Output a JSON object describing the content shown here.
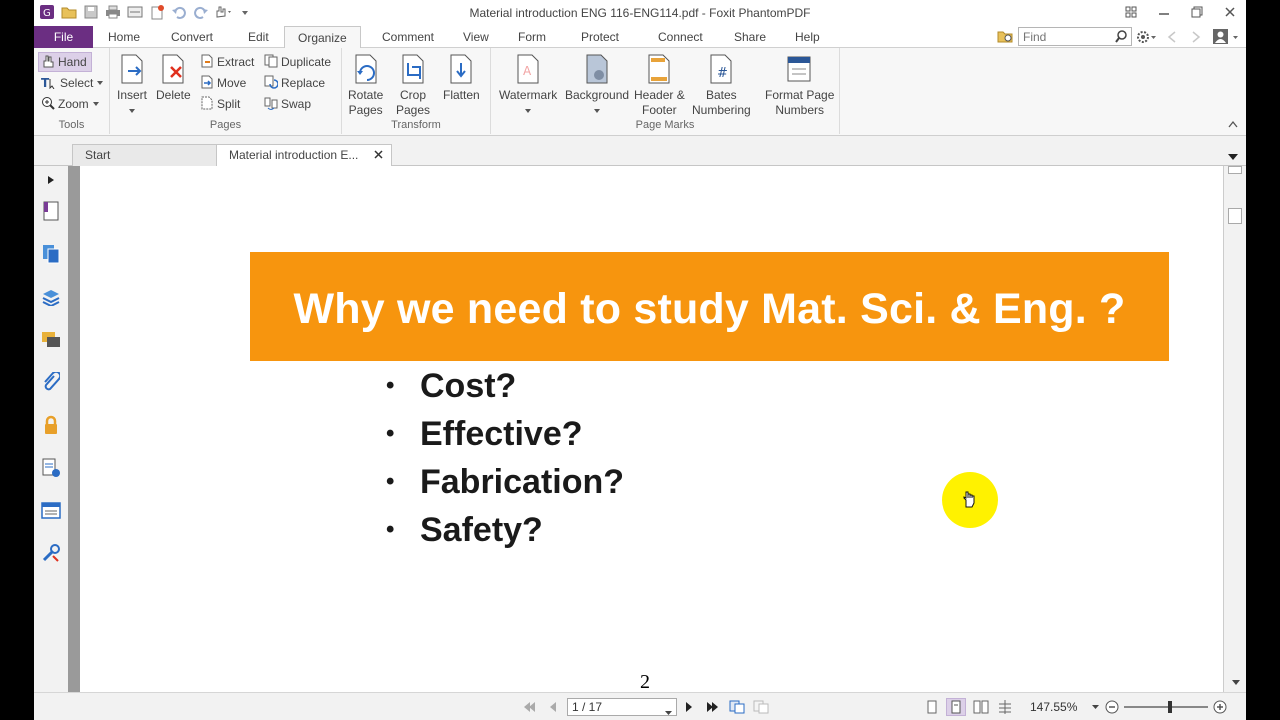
{
  "window": {
    "title": "Material introduction ENG 116-ENG114.pdf - Foxit PhantomPDF"
  },
  "menu": {
    "file": "File",
    "tabs": [
      "Home",
      "Convert",
      "Edit",
      "Organize",
      "Comment",
      "View",
      "Form",
      "Protect",
      "Connect",
      "Share",
      "Help"
    ],
    "active_tab": "Organize",
    "find_placeholder": "Find"
  },
  "ribbon": {
    "tools": {
      "label": "Tools",
      "hand": "Hand",
      "select": "Select",
      "zoom": "Zoom"
    },
    "pages": {
      "label": "Pages",
      "insert": "Insert",
      "delete": "Delete",
      "extract": "Extract",
      "move": "Move",
      "split": "Split",
      "duplicate": "Duplicate",
      "replace": "Replace",
      "swap": "Swap"
    },
    "transform": {
      "label": "Transform",
      "rotate_1": "Rotate",
      "rotate_2": "Pages",
      "crop_1": "Crop",
      "crop_2": "Pages",
      "flatten": "Flatten"
    },
    "page_marks": {
      "label": "Page Marks",
      "watermark": "Watermark",
      "background": "Background",
      "header_1": "Header &",
      "header_2": "Footer",
      "bates_1": "Bates",
      "bates_2": "Numbering",
      "format_1": "Format Page",
      "format_2": "Numbers"
    }
  },
  "doc_tabs": {
    "start": "Start",
    "current": "Material introduction E..."
  },
  "slide": {
    "title": "Why we need to study Mat. Sci. & Eng. ?",
    "bullet_char": "•",
    "bullets": [
      "Cost?",
      "Effective?",
      "Fabrication?",
      "Safety?"
    ],
    "page_number": "2",
    "banner_color": "#f7950e"
  },
  "status": {
    "page": "1 / 17",
    "zoom": "147.55%"
  },
  "colors": {
    "file_tab": "#6b2e82",
    "cursor_highlight": "#fff200"
  }
}
